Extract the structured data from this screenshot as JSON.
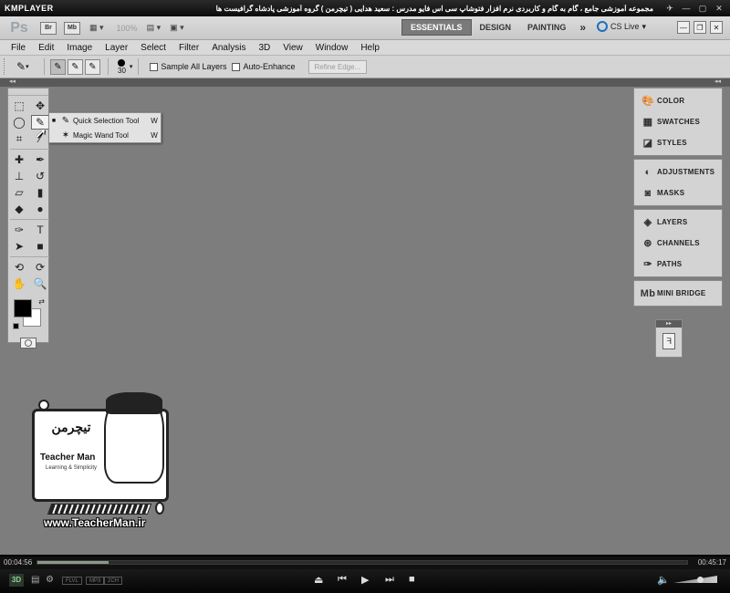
{
  "player": {
    "logo": "KMPLAYER",
    "window_title": "مجموعه آموزشی جامع ، گام به گام و کاربردی نرم افزار فتوشاپ سی اس فایو   مدرس : سعید هدایی ( تیچرمن ) گروه آموزشی پادشاه گرافیست ها",
    "time_elapsed": "00:04:56",
    "time_total": "00:45:17",
    "progress_fraction": 0.11,
    "three_d": "3D",
    "codecs": [
      "FLVL",
      "MP3",
      "2CH"
    ],
    "volume_fraction": 0.6
  },
  "appbar": {
    "ps_logo": "Ps",
    "bridge": "Br",
    "minibridge": "Mb",
    "zoom": "100%",
    "workspaces": [
      "ESSENTIALS",
      "DESIGN",
      "PAINTING"
    ],
    "more": "»",
    "cs_live": "CS Live"
  },
  "menu": [
    "File",
    "Edit",
    "Image",
    "Layer",
    "Select",
    "Filter",
    "Analysis",
    "3D",
    "View",
    "Window",
    "Help"
  ],
  "options": {
    "brush_size": "30",
    "sample_all_layers": "Sample All Layers",
    "auto_enhance": "Auto-Enhance",
    "refine_edge": "Refine Edge..."
  },
  "flyout": {
    "items": [
      {
        "label": "Quick Selection Tool",
        "key": "W",
        "selected": true
      },
      {
        "label": "Magic Wand Tool",
        "key": "W",
        "selected": false
      }
    ]
  },
  "panels": {
    "group1": [
      "COLOR",
      "SWATCHES",
      "STYLES"
    ],
    "group2": [
      "ADJUSTMENTS",
      "MASKS"
    ],
    "group3": [
      "LAYERS",
      "CHANNELS",
      "PATHS"
    ],
    "group4": [
      "MINI BRIDGE"
    ]
  },
  "watermark": {
    "farsi": "تیچرمن",
    "brand": "Teacher Man",
    "tagline": "Learning & Simplicity",
    "url": "www.TeacherMan.ir"
  }
}
